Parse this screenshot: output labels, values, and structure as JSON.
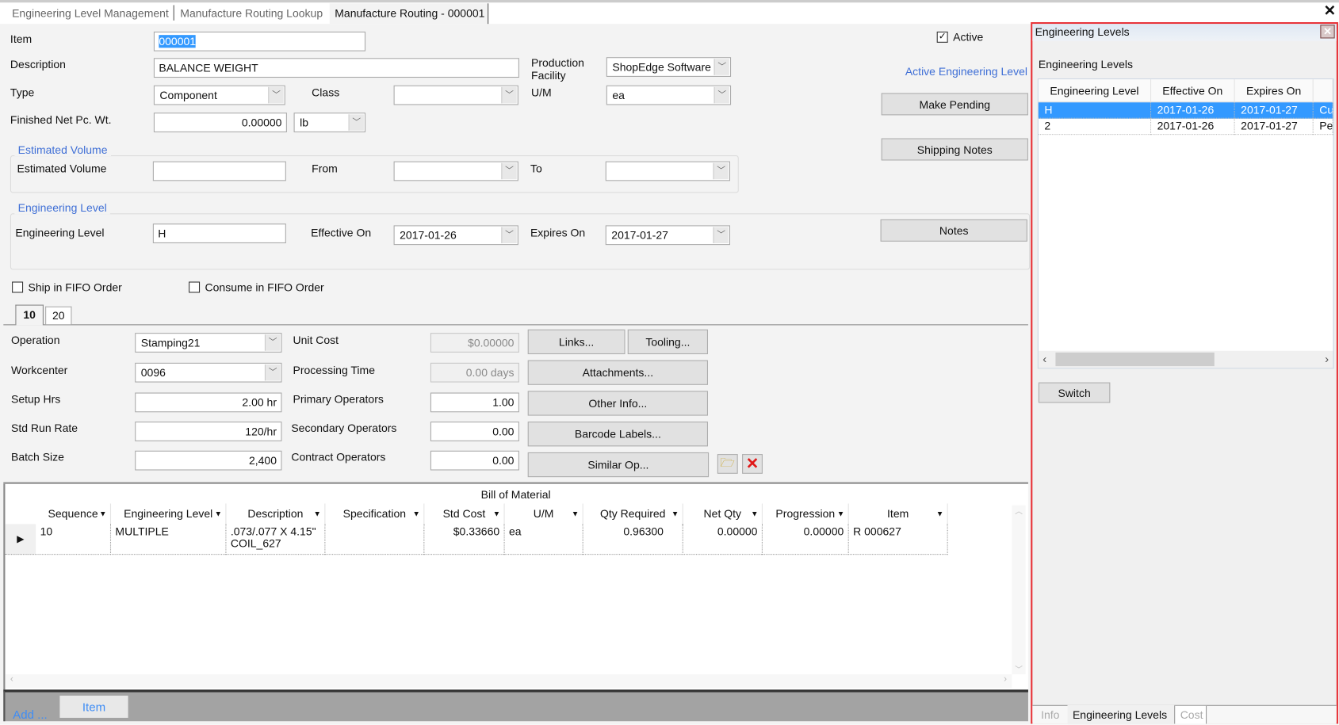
{
  "tabs": [
    {
      "label": "Engineering Level Management",
      "active": false
    },
    {
      "label": "Manufacture Routing Lookup",
      "active": false
    },
    {
      "label": "Manufacture Routing - 000001",
      "active": true
    }
  ],
  "form": {
    "item_label": "Item",
    "item_value": "000001",
    "description_label": "Description",
    "description_value": "BALANCE WEIGHT",
    "production_facility_label": "Production Facility",
    "production_facility_value": "ShopEdge Software",
    "active_label": "Active",
    "active_checked": true,
    "active_eng_level_link": "Active Engineering Level",
    "type_label": "Type",
    "type_value": "Component",
    "class_label": "Class",
    "class_value": "",
    "um_label": "U/M",
    "um_value": "ea",
    "make_pending": "Make Pending",
    "net_wt_label": "Finished Net Pc. Wt.",
    "net_wt_value": "0.00000",
    "net_wt_unit": "lb",
    "shipping_notes": "Shipping Notes",
    "est_group": "Estimated Volume",
    "est_label": "Estimated Volume",
    "est_value": "",
    "from_label": "From",
    "from_value": "",
    "to_label": "To",
    "to_value": "",
    "eng_group": "Engineering Level",
    "eng_label": "Engineering Level",
    "eng_value": "H",
    "eff_label": "Effective On",
    "eff_value": "2017-01-26",
    "exp_label": "Expires On",
    "exp_value": "2017-01-27",
    "notes": "Notes",
    "fifo_ship": "Ship in FIFO Order",
    "fifo_consume": "Consume in FIFO Order"
  },
  "op_tabs": [
    {
      "label": "10",
      "active": true
    },
    {
      "label": "20",
      "active": false
    }
  ],
  "operation": {
    "operation_label": "Operation",
    "operation_value": "Stamping21",
    "workcenter_label": "Workcenter",
    "workcenter_value": "0096",
    "setup_label": "Setup Hrs",
    "setup_value": "2.00 hr",
    "run_label": "Std Run Rate",
    "run_value": "120/hr",
    "batch_label": "Batch Size",
    "batch_value": "2,400",
    "unit_cost_label": "Unit Cost",
    "unit_cost_value": "$0.00000",
    "proc_label": "Processing Time",
    "proc_value": "0.00 days",
    "primary_label": "Primary Operators",
    "primary_value": "1.00",
    "secondary_label": "Secondary Operators",
    "secondary_value": "0.00",
    "contract_label": "Contract Operators",
    "contract_value": "0.00",
    "links": "Links...",
    "tooling": "Tooling...",
    "attachments": "Attachments...",
    "other_info": "Other Info...",
    "barcode": "Barcode Labels...",
    "similar": "Similar Op..."
  },
  "bom": {
    "title": "Bill of Material",
    "columns": [
      "Sequence",
      "Engineering Level",
      "Description",
      "Specification",
      "Std Cost",
      "U/M",
      "Qty Required",
      "Net Qty",
      "Progression",
      "Item"
    ],
    "rows": [
      {
        "sequence": "10",
        "eng_level": "MULTIPLE",
        "description": ".073/.077 X 4.15\" COIL_627",
        "specification": "",
        "std_cost": "$0.33660",
        "um": "ea",
        "qty_required": "0.96300",
        "net_qty": "0.00000",
        "progression": "0.00000",
        "item": "R 000627"
      }
    ]
  },
  "bottom": {
    "add": "Add ...",
    "item": "Item"
  },
  "panel": {
    "title": "Engineering Levels",
    "heading": "Engineering Levels",
    "columns": [
      "Engineering Level",
      "Effective On",
      "Expires On",
      ""
    ],
    "rows": [
      {
        "level": "H",
        "effective": "2017-01-26",
        "expires": "2017-01-27",
        "status": "Cur",
        "selected": true
      },
      {
        "level": "2",
        "effective": "2017-01-26",
        "expires": "2017-01-27",
        "status": "Per",
        "selected": false
      }
    ],
    "switch": "Switch",
    "tabs": [
      {
        "label": "Info",
        "active": false
      },
      {
        "label": "Engineering Levels",
        "active": true
      },
      {
        "label": "Cost",
        "active": false
      }
    ]
  },
  "colors": {
    "accent": "#3f6fd6",
    "selection": "#3399ff",
    "highlight_border": "#e8343a"
  }
}
